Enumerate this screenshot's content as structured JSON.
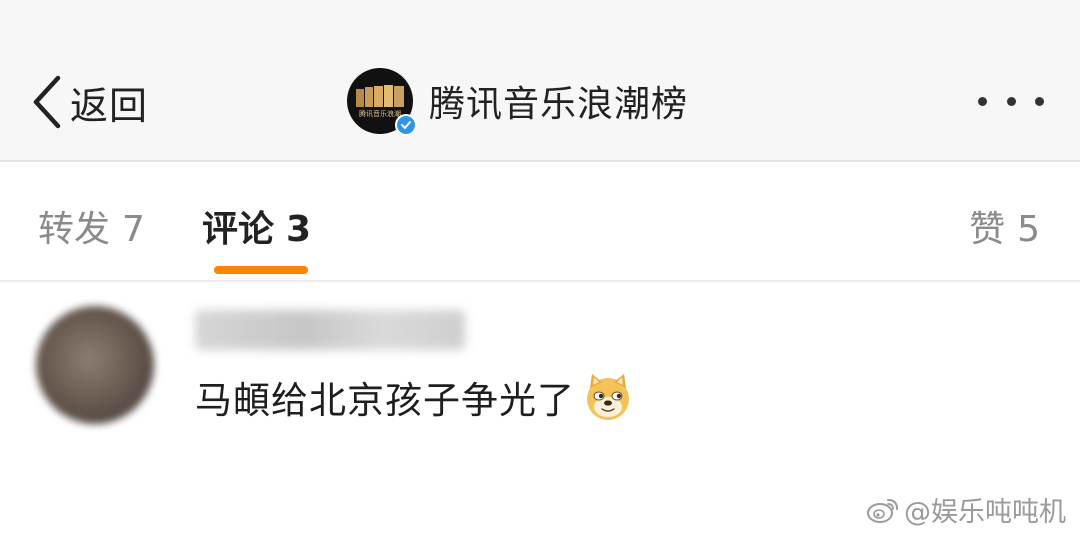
{
  "nav": {
    "back_label": "返回",
    "account_name": "腾讯音乐浪潮榜",
    "account_avatar_text": "腾讯音乐浪潮"
  },
  "tabs": {
    "forward": {
      "label": "转发",
      "count": "7"
    },
    "comments": {
      "label": "评论",
      "count": "3"
    },
    "likes": {
      "label": "赞",
      "count": "5"
    },
    "active": "comments"
  },
  "comments": [
    {
      "username": "",
      "text": "马頔给北京孩子争光了",
      "emoji": "doge-emoji"
    }
  ],
  "watermark": {
    "text": "@娱乐吨吨机"
  },
  "colors": {
    "accent": "#ff8200",
    "verified": "#2f95e8",
    "nav_background": "#f7f7f7",
    "text_primary": "#222222",
    "text_secondary": "#8a8a8a"
  },
  "icons": {
    "back": "chevron-left-icon",
    "more": "more-dots-icon",
    "verified": "verified-badge-icon",
    "watermark": "weibo-logo-icon"
  }
}
